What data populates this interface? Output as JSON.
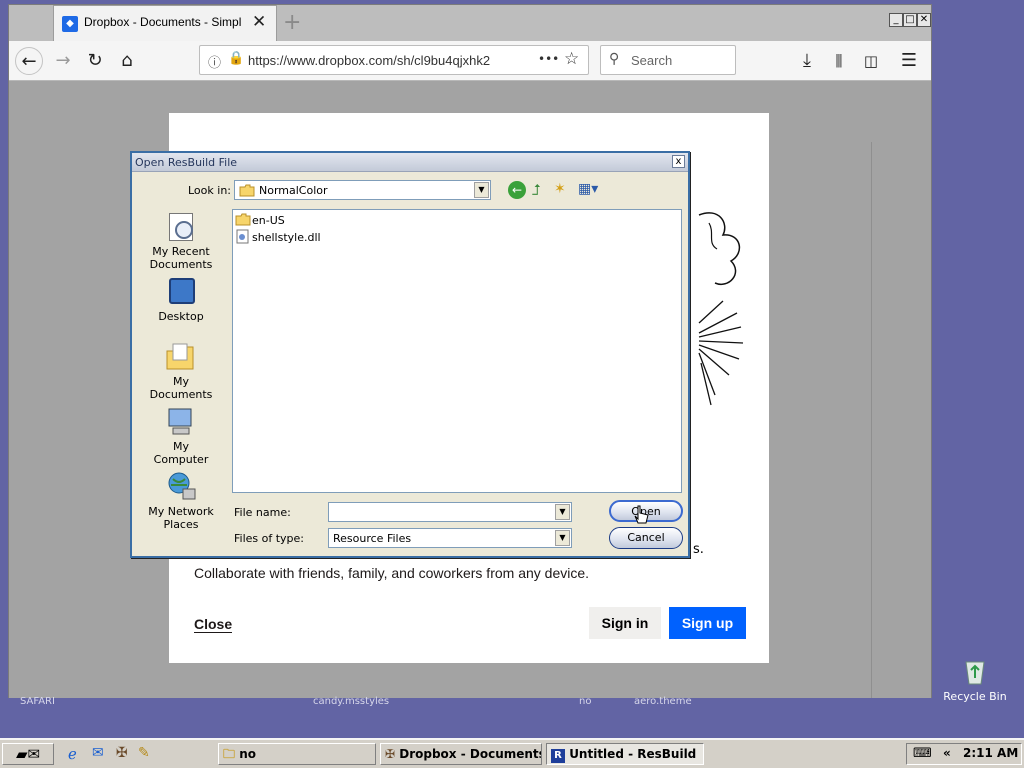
{
  "browser": {
    "tab_title": "Dropbox - Documents - Simplify yo",
    "url": "https://www.dropbox.com/sh/cl9bu4qjxhk2",
    "url_more": "•••",
    "search_placeholder": "Search",
    "new_tab": "+"
  },
  "page": {
    "collab_text": "Collaborate with friends, family, and coworkers from any device.",
    "trailing_text": "s.",
    "close_link": "Close",
    "signin_button": "Sign in",
    "signup_button": "Sign up",
    "brand_color": "#0061fe"
  },
  "dialog": {
    "title": "Open ResBuild File",
    "close": "x",
    "lookin_label": "Look in:",
    "lookin_value": "NormalColor",
    "places": [
      {
        "label": "My Recent Documents"
      },
      {
        "label": "Desktop"
      },
      {
        "label": "My Documents"
      },
      {
        "label": "My Computer"
      },
      {
        "label": "My Network Places"
      }
    ],
    "files": [
      {
        "name": "en-US",
        "icon": "folder-icon"
      },
      {
        "name": "shellstyle.dll",
        "icon": "dll-file-icon"
      }
    ],
    "filename_label": "File name:",
    "filename_value": "",
    "filetype_label": "Files of type:",
    "filetype_value": "Resource Files",
    "open_button": "Open",
    "cancel_button": "Cancel"
  },
  "desktop": {
    "labels": [
      "SAFARI",
      "candy.msstyles",
      "no",
      "aero.theme"
    ],
    "recycle_bin": "Recycle Bin"
  },
  "taskbar": {
    "tasks": [
      {
        "label": "no"
      },
      {
        "label": "Dropbox - Documents..."
      },
      {
        "label": "Untitled - ResBuild"
      }
    ],
    "tray_arrow": "«",
    "clock": "2:11 AM"
  }
}
